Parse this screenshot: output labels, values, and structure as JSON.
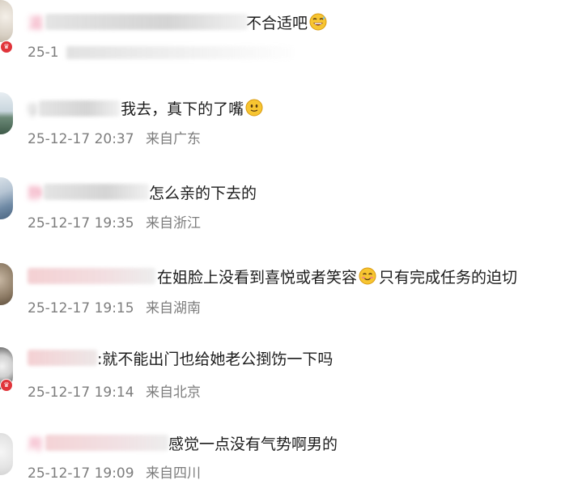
{
  "comments": [
    {
      "user_name": "湄",
      "text": "不合适吧",
      "emoji": "grinning-sweat-emoji",
      "timestamp": "25-1",
      "location": ""
    },
    {
      "user_name": "g",
      "text": "我去，真下的了嘴",
      "emoji": "smile-emoji",
      "timestamp": "25-12-17 20:37",
      "location": "来自广东"
    },
    {
      "user_name": "静",
      "text": "怎么亲的下去的",
      "emoji": "",
      "timestamp": "25-12-17 19:35",
      "location": "来自浙江"
    },
    {
      "user_name": "",
      "text": "在姐脸上没看到喜悦或者笑容",
      "text_after_emoji": "只有完成任务的迫切",
      "emoji": "blush-emoji",
      "timestamp": "25-12-17 19:15",
      "location": "来自湖南"
    },
    {
      "user_name": "",
      "text": ":就不能出门也给她老公捯饬一下吗",
      "emoji": "",
      "timestamp": "25-12-17 19:14",
      "location": "来自北京"
    },
    {
      "user_name": "用",
      "text": "感觉一点没有气势啊男的",
      "emoji": "",
      "timestamp": "25-12-17 19:09",
      "location": "来自四川"
    }
  ],
  "colors": {
    "user_name": "#e96a8e",
    "comment_text": "#1c1c1c",
    "meta_text": "#7d7d7d",
    "vip_badge": "#e0343a"
  }
}
